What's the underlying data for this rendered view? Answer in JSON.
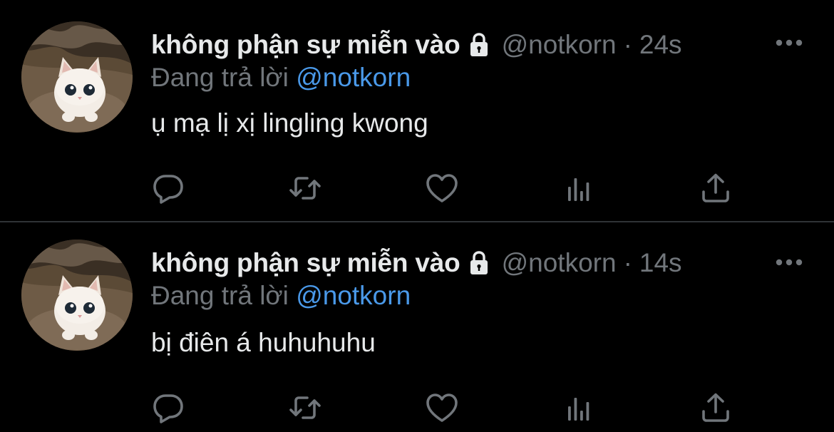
{
  "colors": {
    "background": "#000000",
    "primary_text": "#e7e9ea",
    "secondary_text": "#71767b",
    "link": "#4a99e9",
    "divider": "#2f3336"
  },
  "tweets": [
    {
      "display_name": "không phận sự miễn vào",
      "lock_icon": "lock-icon",
      "handle": "@notkorn",
      "separator": "·",
      "time": "24s",
      "reply_prefix": "Đang trả lời",
      "reply_to": "@notkorn",
      "text": "ụ mạ lị xị lingling kwong",
      "avatar": "kitten-avatar",
      "actions": [
        "reply-icon",
        "retweet-icon",
        "like-icon",
        "views-icon",
        "share-icon"
      ]
    },
    {
      "display_name": "không phận sự miễn vào",
      "lock_icon": "lock-icon",
      "handle": "@notkorn",
      "separator": "·",
      "time": "14s",
      "reply_prefix": "Đang trả lời",
      "reply_to": "@notkorn",
      "text": "bị điên á huhuhuhu",
      "avatar": "kitten-avatar",
      "actions": [
        "reply-icon",
        "retweet-icon",
        "like-icon",
        "views-icon",
        "share-icon"
      ]
    }
  ]
}
